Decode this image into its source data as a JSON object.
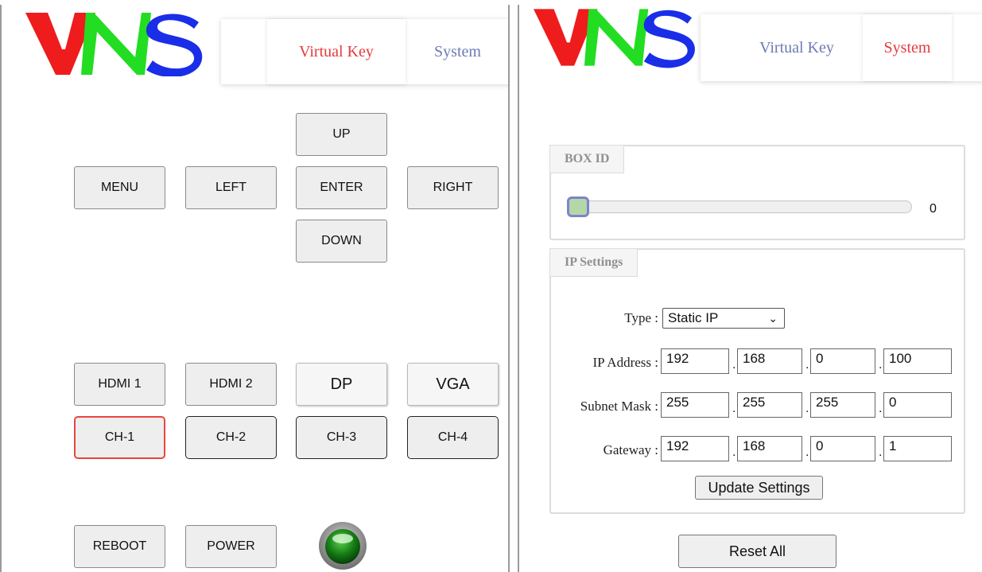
{
  "left": {
    "tabs": [
      {
        "label": "Virtual Key",
        "active": true
      },
      {
        "label": "System",
        "active": false
      }
    ],
    "nav": {
      "up": "UP",
      "menu": "MENU",
      "left": "LEFT",
      "enter": "ENTER",
      "right": "RIGHT",
      "down": "DOWN"
    },
    "sources": [
      "HDMI 1",
      "HDMI 2",
      "DP",
      "VGA"
    ],
    "channels": [
      {
        "label": "CH-1",
        "selected": true
      },
      {
        "label": "CH-2",
        "selected": false
      },
      {
        "label": "CH-3",
        "selected": false
      },
      {
        "label": "CH-4",
        "selected": false
      }
    ],
    "actions": {
      "reboot": "REBOOT",
      "power": "POWER"
    },
    "power_led": "on-green"
  },
  "right": {
    "tabs": [
      {
        "label": "Virtual Key",
        "active": false
      },
      {
        "label": "System",
        "active": true
      }
    ],
    "box_id": {
      "legend": "BOX ID",
      "value": "0",
      "min": 0,
      "max": 15
    },
    "ip_settings": {
      "legend": "IP Settings",
      "type_label": "Type :",
      "type_value": "Static IP",
      "ip_label": "IP Address :",
      "ip": [
        "192",
        "168",
        "0",
        "100"
      ],
      "mask_label": "Subnet Mask :",
      "mask": [
        "255",
        "255",
        "255",
        "0"
      ],
      "gateway_label": "Gateway :",
      "gateway": [
        "192",
        "168",
        "0",
        "1"
      ],
      "separator": ".",
      "update_button": "Update Settings"
    },
    "reset_button": "Reset All"
  },
  "colors": {
    "logo_v": "#ee1c1c",
    "logo_n": "#22dd22",
    "logo_s": "#1a2ee8",
    "active_tab": "#e53b3b",
    "inactive_tab": "#6d7bb3",
    "selected_channel": "#e9453d"
  }
}
